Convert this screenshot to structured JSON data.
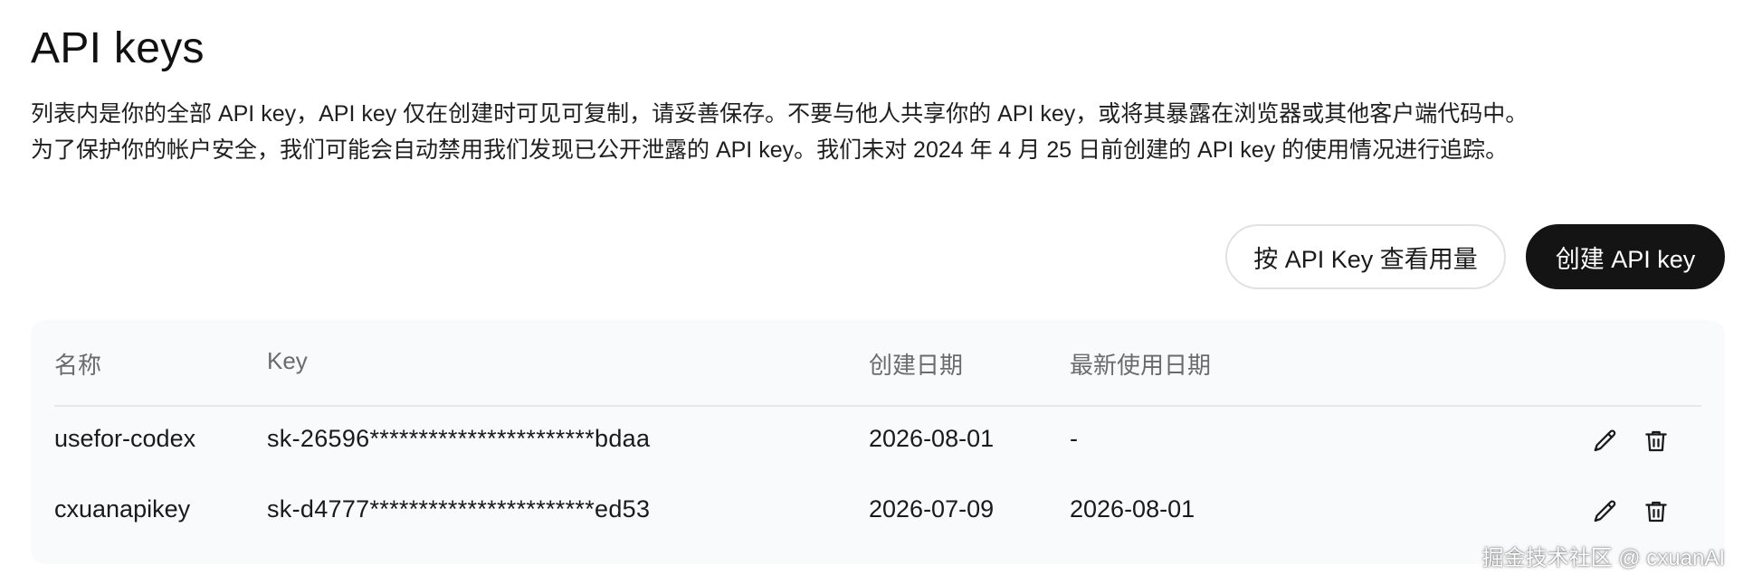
{
  "page": {
    "title": "API keys",
    "description_lines": [
      "列表内是你的全部 API key，API key 仅在创建时可见可复制，请妥善保存。不要与他人共享你的 API key，或将其暴露在浏览器或其他客户端代码中。",
      "为了保护你的帐户安全，我们可能会自动禁用我们发现已公开泄露的 API key。我们未对 2024 年 4 月 25 日前创建的 API key 的使用情况进行追踪。"
    ]
  },
  "actions": {
    "usage_button_label": "按 API Key 查看用量",
    "create_button_label": "创建 API key"
  },
  "table": {
    "columns": {
      "name": "名称",
      "key": "Key",
      "created": "创建日期",
      "last_used": "最新使用日期"
    },
    "rows": [
      {
        "name": "usefor-codex",
        "key": "sk-26596***********************bdaa",
        "created": "2026-08-01",
        "last_used": "-",
        "edit_icon": "pencil-icon",
        "delete_icon": "trash-icon"
      },
      {
        "name": "cxuanapikey",
        "key": "sk-d4777***********************ed53",
        "created": "2026-07-09",
        "last_used": "2026-08-01",
        "edit_icon": "pencil-icon",
        "delete_icon": "trash-icon"
      }
    ]
  },
  "watermark": "掘金技术社区 @ cxuanAI",
  "colors": {
    "primary_button_bg": "#141414",
    "primary_button_text": "#ffffff",
    "table_bg": "#f9fafb",
    "header_text": "#6b6b6b"
  }
}
